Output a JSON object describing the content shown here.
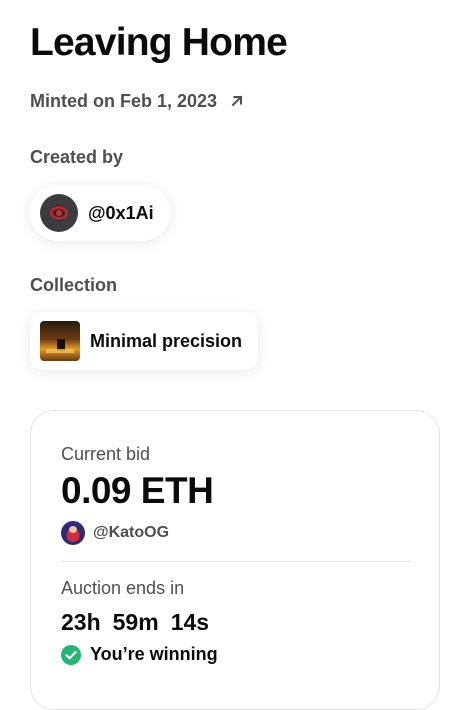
{
  "nft": {
    "title": "Leaving Home",
    "minted_text": "Minted on Feb 1, 2023"
  },
  "creator": {
    "section_label": "Created by",
    "handle": "@0x1Ai"
  },
  "collection": {
    "section_label": "Collection",
    "name": "Minimal precision"
  },
  "auction": {
    "current_bid_label": "Current bid",
    "current_bid_value": "0.09 ETH",
    "top_bidder": "@KatoOG",
    "ends_label": "Auction ends in",
    "countdown": {
      "hours": "23h",
      "minutes": "59m",
      "seconds": "14s"
    },
    "status_text": "You’re winning"
  },
  "icons": {
    "minted_link": "arrow-up-right-icon",
    "status": "check-circle-icon"
  },
  "colors": {
    "text_primary": "#0b0b0b",
    "text_secondary": "#4f4f4f",
    "success": "#22b573",
    "border": "#e4e4e4"
  }
}
